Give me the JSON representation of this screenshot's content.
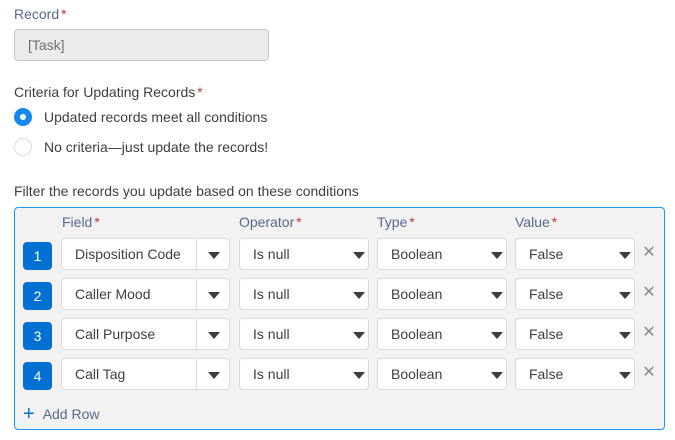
{
  "record": {
    "label": "Record",
    "required_mark": "*",
    "value": "[Task]"
  },
  "criteria": {
    "label": "Criteria for Updating Records",
    "required_mark": "*",
    "options": [
      {
        "label": "Updated records meet all conditions",
        "checked": true
      },
      {
        "label": "No criteria—just update the records!",
        "checked": false
      }
    ]
  },
  "filter": {
    "label": "Filter the records you update based on these conditions",
    "columns": {
      "field": "Field",
      "operator": "Operator",
      "type": "Type",
      "value": "Value"
    },
    "required_mark": "*",
    "rows": [
      {
        "num": "1",
        "field": "Disposition Code",
        "operator": "Is null",
        "type": "Boolean",
        "value": "False"
      },
      {
        "num": "2",
        "field": "Caller Mood",
        "operator": "Is null",
        "type": "Boolean",
        "value": "False"
      },
      {
        "num": "3",
        "field": "Call Purpose",
        "operator": "Is null",
        "type": "Boolean",
        "value": "False"
      },
      {
        "num": "4",
        "field": "Call Tag",
        "operator": "Is null",
        "type": "Boolean",
        "value": "False"
      }
    ],
    "add_row_label": "Add Row"
  },
  "icons": {
    "delete": "close-icon",
    "dropdown": "chevron-down-icon",
    "add": "plus-icon"
  },
  "colors": {
    "accent": "#0070d2",
    "radio_checked": "#1589ee",
    "required": "#c23934",
    "filter_border": "#1b96ff"
  }
}
